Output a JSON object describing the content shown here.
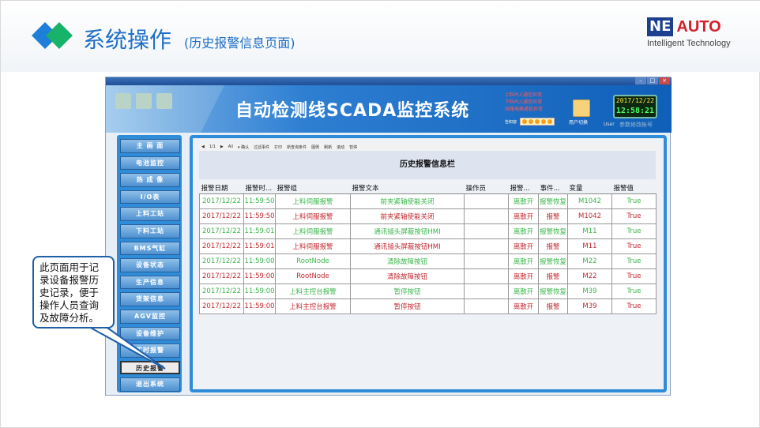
{
  "slide": {
    "title": "系统操作",
    "subtitle": "(历史报警信息页面)",
    "logo": {
      "ne": "NE",
      "auto": "AUTO",
      "tagline": "Intelligent Technology"
    }
  },
  "window": {
    "controls": [
      "–",
      "□",
      "×"
    ],
    "system_title": "自动检测线SCADA监控系统",
    "alarms": [
      "上料PLC通信异常",
      "下料PLC通信异常",
      "线路电箱通信异常"
    ],
    "alarm_indicator_label": "告知窗",
    "user_switch": "用户切换",
    "clock_date": "2017/12/22",
    "clock_time": "12:58:21",
    "user_label": "User",
    "user_name": "参数修改帐号"
  },
  "sidebar": {
    "items": [
      {
        "label": "主 画 面"
      },
      {
        "label": "电池监控"
      },
      {
        "label": "热 成 像"
      },
      {
        "label": "I/O表"
      },
      {
        "label": "上料工站"
      },
      {
        "label": "下料工站"
      },
      {
        "label": "BMS气缸"
      },
      {
        "label": "设备状态"
      },
      {
        "label": "生产信息"
      },
      {
        "label": "货架信息"
      },
      {
        "label": "AGV监控"
      },
      {
        "label": "设备维护"
      },
      {
        "label": "实时报警"
      },
      {
        "label": "历史报警"
      },
      {
        "label": "退出系统"
      }
    ],
    "active_index": 13
  },
  "toolbar": {
    "items": [
      "◀",
      "1/1",
      "▶",
      "All",
      "▾ 确认",
      "过滤事件",
      "打印",
      "新查询条件",
      "图例",
      "刷新",
      "滚动",
      "暂停"
    ]
  },
  "panel": {
    "title": "历史报警信息栏",
    "columns": [
      "报警日期",
      "报警时...",
      "报警组",
      "报警文本",
      "操作员",
      "报警...",
      "事件...",
      "变量",
      "报警值"
    ],
    "rows": [
      {
        "status": "ok",
        "cells": [
          "2017/12/22",
          "11:59:50",
          "上料伺服报警",
          "前夹紧轴使能关闭",
          "",
          "离散开",
          "报警恢复",
          "M1042",
          "True"
        ]
      },
      {
        "status": "alarm",
        "cells": [
          "2017/12/22",
          "11:59:50",
          "上料伺服报警",
          "前夹紧轴使能关闭",
          "",
          "离散开",
          "报警",
          "M1042",
          "True"
        ]
      },
      {
        "status": "ok",
        "cells": [
          "2017/12/22",
          "11:59:01",
          "上料伺服报警",
          "通讯插头屏蔽按钮HMI",
          "",
          "离散开",
          "报警恢复",
          "M11",
          "True"
        ]
      },
      {
        "status": "alarm",
        "cells": [
          "2017/12/22",
          "11:59:01",
          "上料伺服报警",
          "通讯插头屏蔽按钮HMI",
          "",
          "离散开",
          "报警",
          "M11",
          "True"
        ]
      },
      {
        "status": "ok",
        "cells": [
          "2017/12/22",
          "11:59:00",
          "RootNode",
          "清除故障按钮",
          "",
          "离散开",
          "报警恢复",
          "M22",
          "True"
        ]
      },
      {
        "status": "alarm",
        "cells": [
          "2017/12/22",
          "11:59:00",
          "RootNode",
          "清除故障按钮",
          "",
          "离散开",
          "报警",
          "M22",
          "True"
        ]
      },
      {
        "status": "ok",
        "cells": [
          "2017/12/22",
          "11:59:00",
          "上料主控台报警",
          "暂停按钮",
          "",
          "离散开",
          "报警恢复",
          "M39",
          "True"
        ]
      },
      {
        "status": "alarm",
        "cells": [
          "2017/12/22",
          "11:59:00",
          "上料主控台报警",
          "暂停按钮",
          "",
          "离散开",
          "报警",
          "M39",
          "True"
        ]
      }
    ]
  },
  "callout": {
    "text": "此页面用于记录设备报警历史记录，便于操作人员查询及故障分析。"
  }
}
